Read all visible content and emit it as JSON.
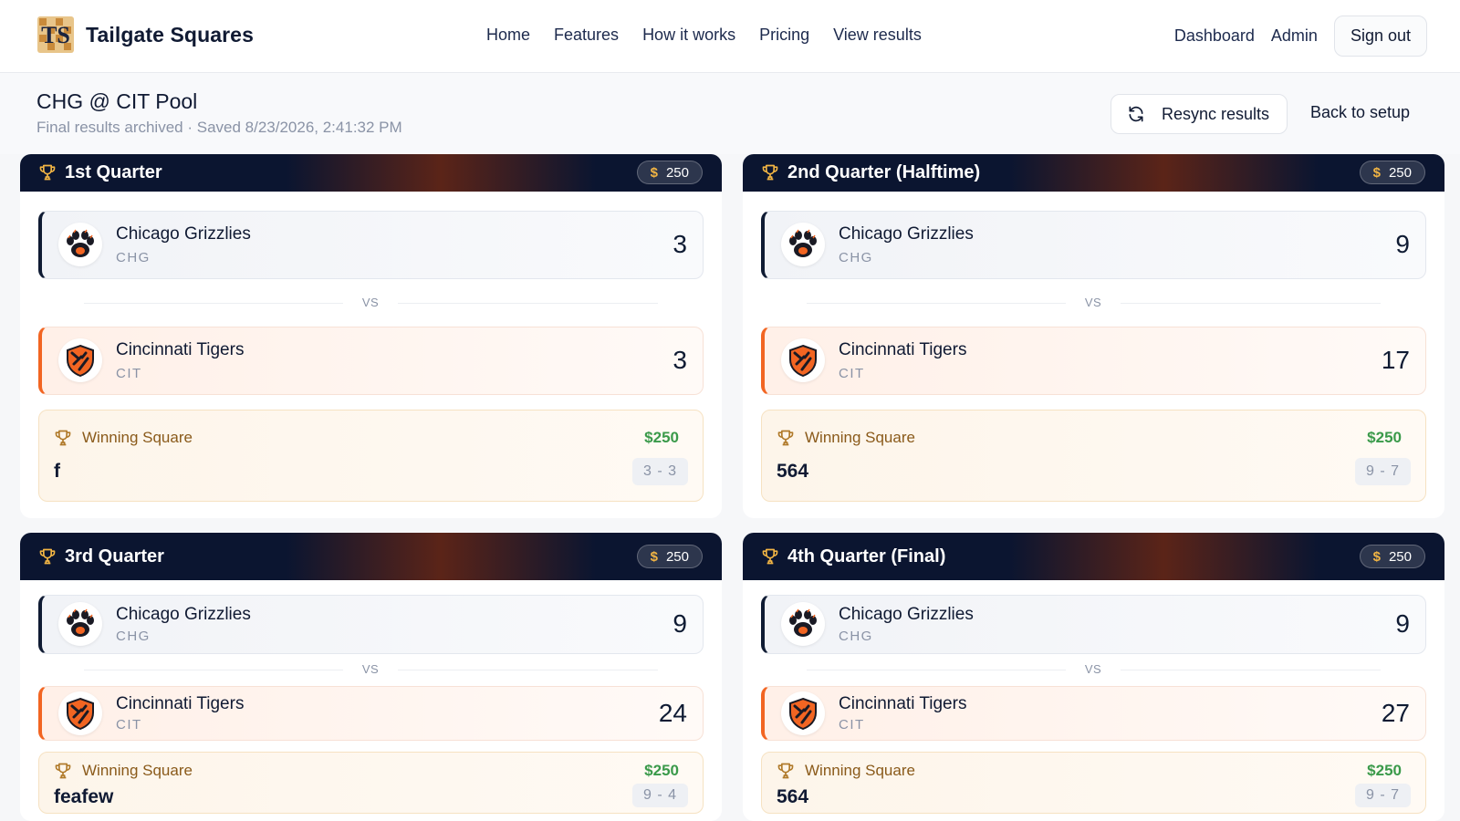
{
  "app": {
    "brand_name": "Tailgate Squares",
    "nav": [
      "Home",
      "Features",
      "How it works",
      "Pricing",
      "View results"
    ],
    "nav_right": {
      "dashboard": "Dashboard",
      "admin": "Admin",
      "sign_out": "Sign out"
    }
  },
  "pool": {
    "title": "CHG @ CIT Pool",
    "subtitle": "Final results archived · Saved 8/23/2026, 2:41:32 PM",
    "resync_label": "Resync results",
    "back_label": "Back to setup"
  },
  "vs_label": "VS",
  "winning_square_label": "Winning Square",
  "teams": {
    "home": {
      "name": "Chicago Grizzlies",
      "abbr": "CHG"
    },
    "away": {
      "name": "Cincinnati Tigers",
      "abbr": "CIT"
    }
  },
  "colors": {
    "navy": "#0f1b33",
    "orange": "#f26522",
    "money_green": "#3a9a4a",
    "gold": "#f2b544"
  },
  "quarters": [
    {
      "title": "1st Quarter",
      "prize": "250",
      "chg_score": "3",
      "cit_score": "3",
      "win_amount": "$250",
      "winner": "f",
      "digits": "3 - 3"
    },
    {
      "title": "2nd Quarter (Halftime)",
      "prize": "250",
      "chg_score": "9",
      "cit_score": "17",
      "win_amount": "$250",
      "winner": "564",
      "digits": "9 - 7"
    },
    {
      "title": "3rd Quarter",
      "prize": "250",
      "chg_score": "9",
      "cit_score": "24",
      "win_amount": "$250",
      "winner": "feafew",
      "digits": "9 - 4"
    },
    {
      "title": "4th Quarter (Final)",
      "prize": "250",
      "chg_score": "9",
      "cit_score": "27",
      "win_amount": "$250",
      "winner": "564",
      "digits": "9 - 7"
    }
  ]
}
